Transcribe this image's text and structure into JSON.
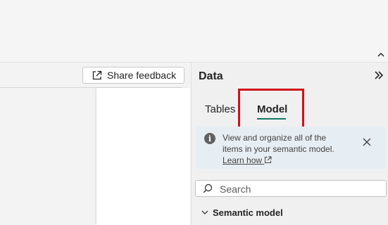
{
  "toolbar": {
    "share_feedback_label": "Share feedback"
  },
  "data_pane": {
    "title": "Data",
    "tabs": [
      {
        "label": "Tables",
        "selected": false
      },
      {
        "label": "Model",
        "selected": true
      }
    ],
    "info": {
      "text": "View and organize all of the items in your semantic model.",
      "link_label": "Learn how"
    },
    "search": {
      "placeholder": "Search",
      "value": ""
    },
    "section": {
      "label": "Semantic model",
      "expanded": true
    }
  },
  "colors": {
    "accent": "#117865",
    "highlight": "#d0101b",
    "info_background": "#e7eef3"
  }
}
